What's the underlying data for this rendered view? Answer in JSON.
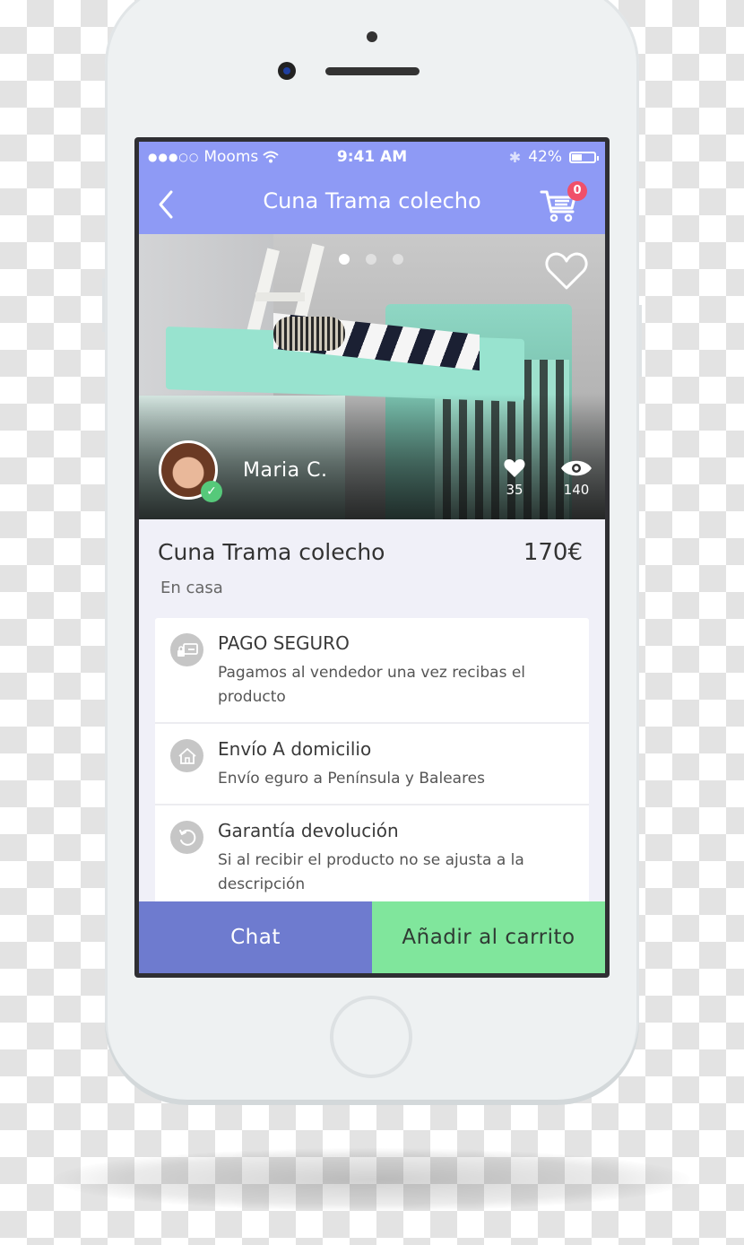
{
  "status_bar": {
    "signal": "●●●○○",
    "carrier": "Mooms",
    "time": "9:41 AM",
    "bluetooth": "✱",
    "battery_percent": "42%",
    "battery_level": 0.42
  },
  "navbar": {
    "title": "Cuna Trama colecho",
    "back_icon": "chevron-left-icon",
    "cart_icon": "shopping-cart-icon",
    "cart_count": "0"
  },
  "gallery": {
    "image_count": 3,
    "active_index": 0,
    "favorite_icon": "heart-outline-icon"
  },
  "seller": {
    "name": "Maria C.",
    "verified": true,
    "verified_icon": "check-icon"
  },
  "stats": {
    "likes": "35",
    "views": "140"
  },
  "product": {
    "title": "Cuna Trama colecho",
    "price": "170€",
    "location": "En casa"
  },
  "features": [
    {
      "icon": "secure-card-icon",
      "title": "PAGO SEGURO",
      "description": "Pagamos al vendedor una vez recibas el producto"
    },
    {
      "icon": "home-icon",
      "title": "Envío A domicilio",
      "description": "Envío eguro a Península y Baleares"
    },
    {
      "icon": "return-icon",
      "title": "Garantía devolución",
      "description": "Si al recibir el producto no se ajusta a la descripción"
    }
  ],
  "actions": {
    "chat_label": "Chat",
    "add_to_cart_label": "Añadir al carrito"
  },
  "colors": {
    "header": "#8e9af5",
    "chat_button": "#6e7bcf",
    "cart_button": "#80e69c",
    "badge": "#f0506a",
    "verified": "#56c97a"
  }
}
